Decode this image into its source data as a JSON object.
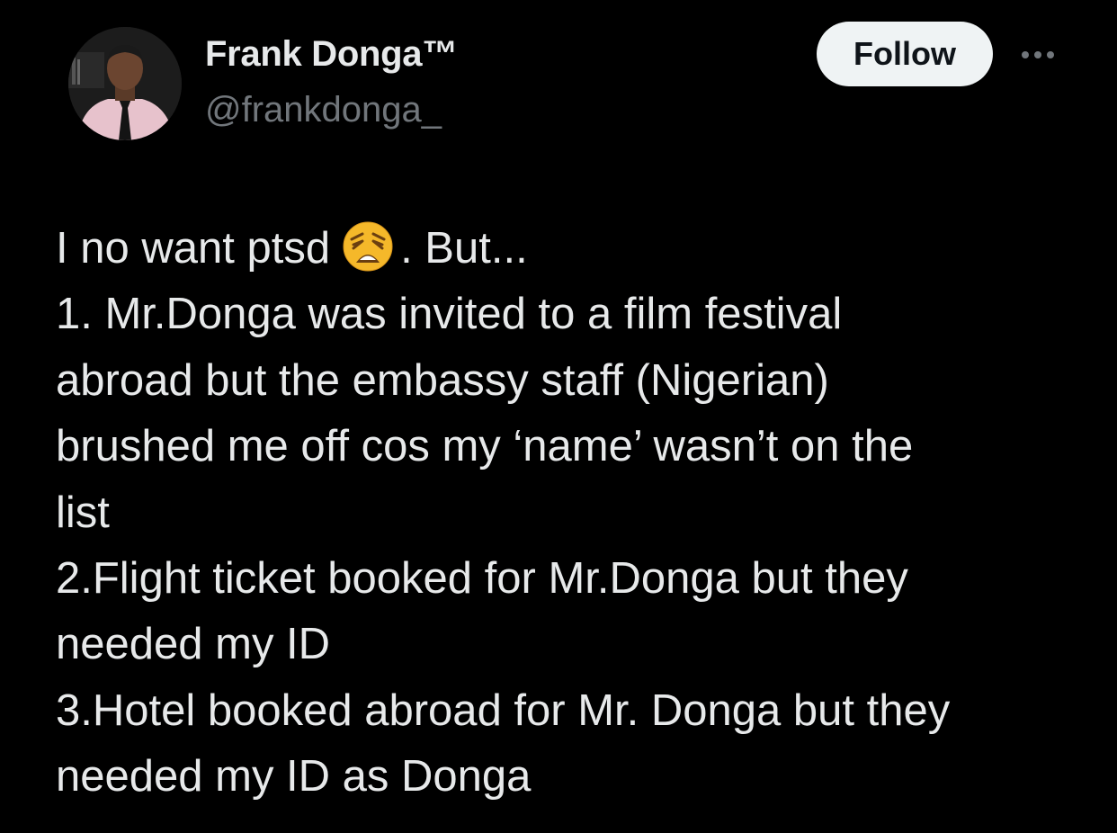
{
  "author": {
    "display_name": "Frank Donga™",
    "handle": "@frankdonga_"
  },
  "actions": {
    "follow_label": "Follow",
    "more_icon": "more-horizontal-icon"
  },
  "tweet": {
    "line1_before": "I no want ptsd",
    "line1_emoji": "weary-face-emoji",
    "line1_after": ". But...",
    "lines": [
      "1. Mr.Donga was invited to a film festival",
      "abroad but the embassy staff (Nigerian)",
      "brushed me off cos my ‘name’ wasn’t on the",
      "list",
      "2.Flight ticket booked for Mr.Donga but they",
      "needed my ID",
      "3.Hotel booked abroad for Mr. Donga but they",
      "needed my ID as Donga"
    ]
  },
  "colors": {
    "background": "#000000",
    "text_primary": "#e7e9ea",
    "text_secondary": "#71767b",
    "follow_bg": "#eff3f4",
    "follow_text": "#0f1419"
  }
}
